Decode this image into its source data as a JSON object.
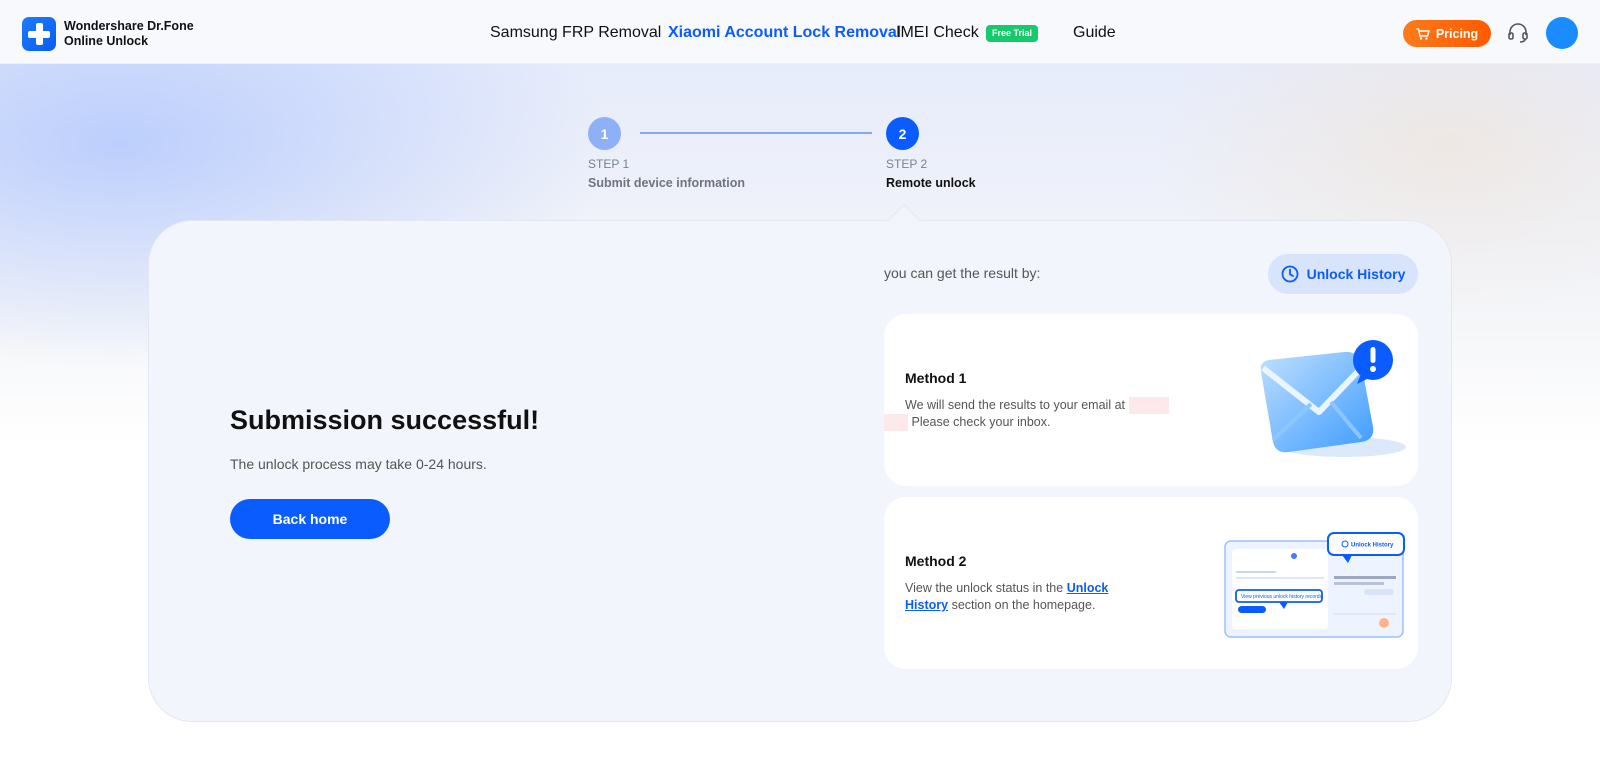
{
  "header": {
    "logo_line1": "Wondershare Dr.Fone",
    "logo_line2": "Online Unlock",
    "nav": {
      "samsung": "Samsung FRP Removal",
      "xiaomi": "Xiaomi Account Lock Removal",
      "imei": "IMEI Check",
      "free_trial": "Free Trial",
      "guide": "Guide"
    },
    "pricing": "Pricing"
  },
  "stepper": {
    "step1": {
      "number": "1",
      "label": "STEP 1",
      "title": "Submit device information"
    },
    "step2": {
      "number": "2",
      "label": "STEP 2",
      "title": "Remote unlock"
    }
  },
  "main": {
    "success_title": "Submission successful!",
    "success_sub": "The unlock process may take 0-24 hours.",
    "back_home": "Back home",
    "result_by": "you can get the result by:",
    "unlock_history_button": "Unlock History"
  },
  "method1": {
    "title": "Method 1",
    "text_part1": "We will send the results to your email at",
    "text_part2": "Please check your inbox."
  },
  "method2": {
    "title": "Method 2",
    "text_part1": "View the unlock status in the",
    "link1": "Unlock",
    "link2": "History",
    "text_part2": "section on the homepage.",
    "mini_button": "Unlock History",
    "mini_hint": "View previous unlock history records"
  },
  "colors": {
    "accent": "#0b5cff",
    "pricing": "#ff6a00",
    "free_trial": "#16c96a"
  }
}
